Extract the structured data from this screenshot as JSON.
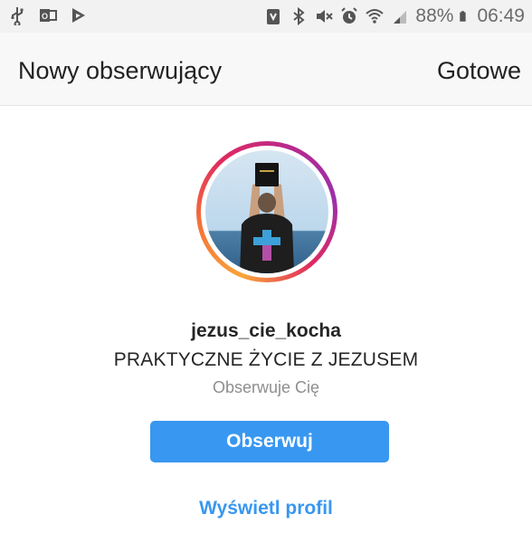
{
  "status_bar": {
    "battery": "88%",
    "time": "06:49",
    "left_icons": [
      "usb-icon",
      "outlook-icon",
      "play-store-icon"
    ],
    "right_icons": [
      "nfc-icon",
      "bluetooth-icon",
      "mute-icon",
      "alarm-icon",
      "wifi-icon",
      "signal-icon",
      "battery-icon"
    ]
  },
  "header": {
    "title": "Nowy obserwujący",
    "done_label": "Gotowe"
  },
  "profile": {
    "username": "jezus_cie_kocha",
    "full_name": "PRAKTYCZNE ŻYCIE Z JEZUSEM",
    "status": "Obserwuje Cię",
    "follow_label": "Obserwuj",
    "view_profile_label": "Wyświetl profil"
  },
  "colors": {
    "accent": "#3897f0",
    "text": "#262626",
    "muted": "#8e8e8e"
  }
}
